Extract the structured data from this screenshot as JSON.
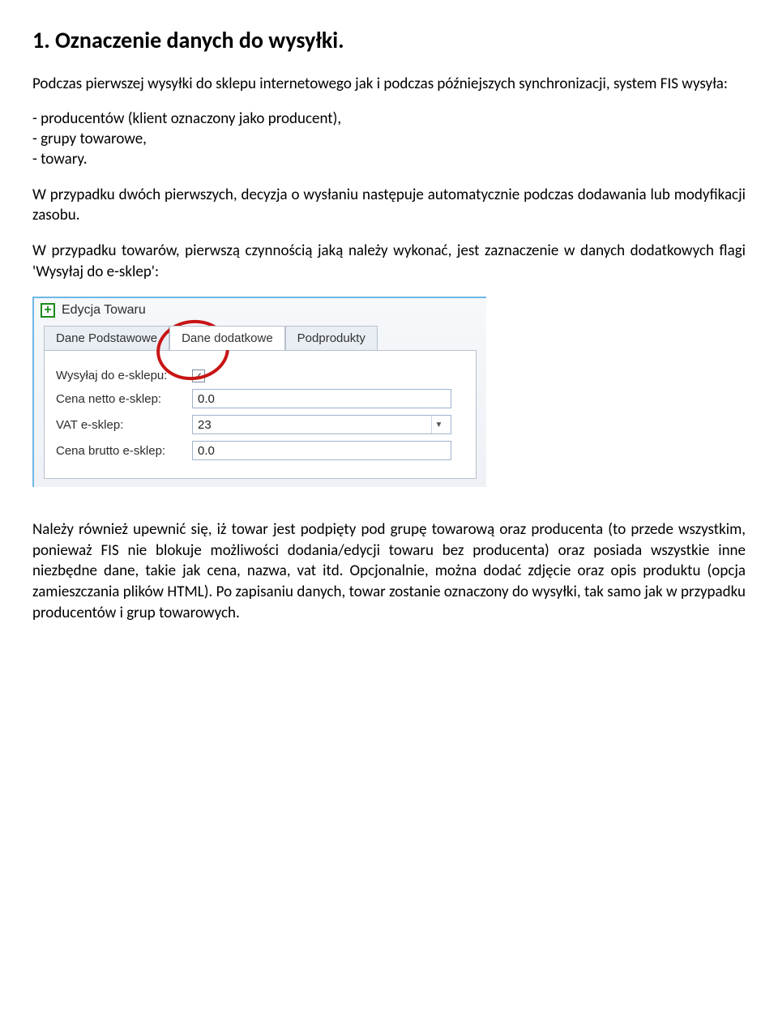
{
  "heading": "1. Oznaczenie danych do wysyłki.",
  "p1": "Podczas pierwszej wysyłki do sklepu internetowego jak i podczas późniejszych synchronizacji, system FIS wysyła:",
  "bullets": [
    "- producentów (klient oznaczony jako producent),",
    "- grupy towarowe,",
    "- towary."
  ],
  "p2": "W przypadku dwóch pierwszych, decyzja o wysłaniu następuje automatycznie podczas dodawania lub modyfikacji zasobu.",
  "p3": "W przypadku towarów, pierwszą czynnością jaką należy wykonać, jest zaznaczenie w danych dodatkowych flagi 'Wysyłaj do e-sklep':",
  "window": {
    "title": "Edycja Towaru",
    "tabs": {
      "t1": "Dane Podstawowe",
      "t2": "Dane dodatkowe",
      "t3": "Podprodukty"
    },
    "rows": {
      "r1_label": "Wysyłaj do e-sklepu:",
      "r1_checked": "✓",
      "r2_label": "Cena netto e-sklep:",
      "r2_value": "0.0",
      "r3_label": "VAT e-sklep:",
      "r3_value": "23",
      "r4_label": "Cena brutto e-sklep:",
      "r4_value": "0.0"
    }
  },
  "p4": "Należy również upewnić się, iż towar jest podpięty pod grupę towarową oraz producenta (to przede wszystkim, ponieważ FIS nie blokuje możliwości dodania/edycji towaru bez producenta) oraz posiada wszystkie inne niezbędne dane, takie jak cena, nazwa, vat itd. Opcjonalnie, można dodać zdjęcie oraz opis produktu (opcja zamieszczania plików HTML). Po zapisaniu danych, towar zostanie oznaczony do wysyłki, tak samo jak w przypadku producentów i grup towarowych."
}
